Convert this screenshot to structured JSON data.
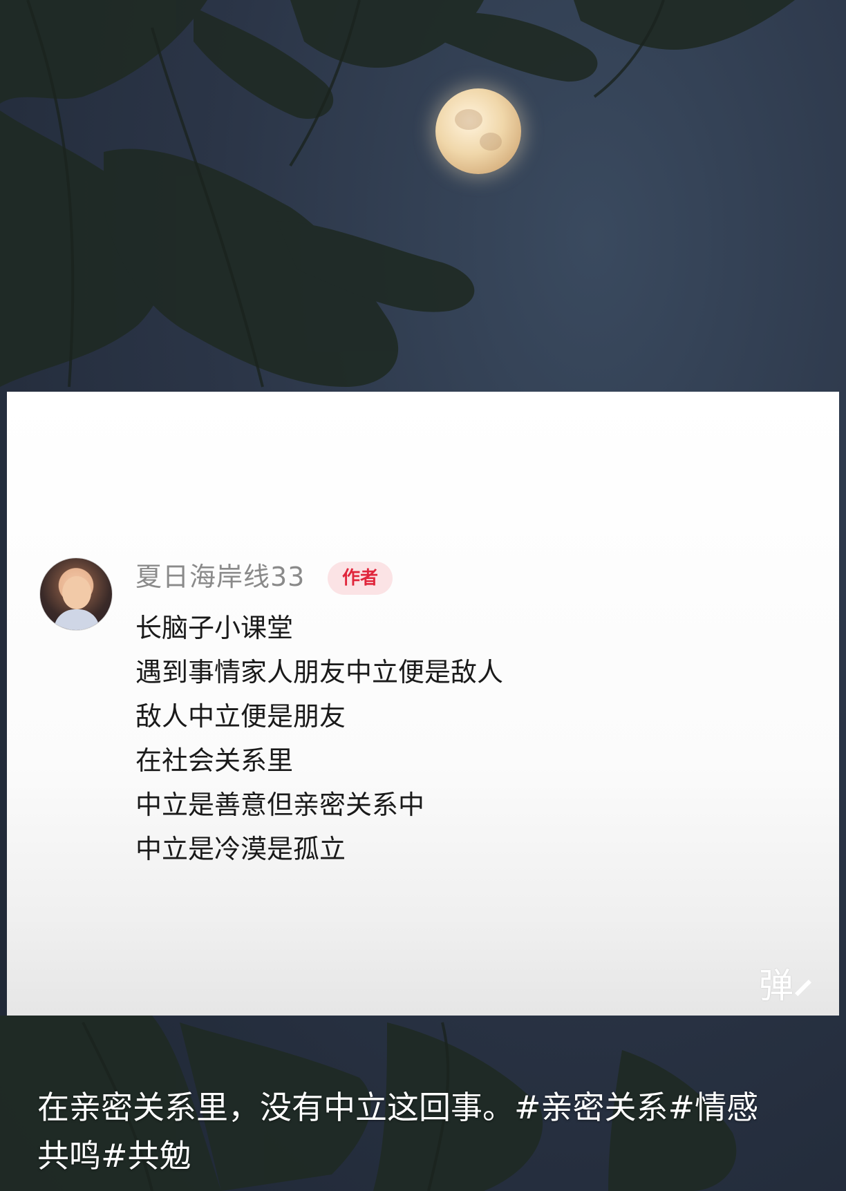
{
  "comment": {
    "username": "夏日海岸线33",
    "badge": "作者",
    "lines": [
      "长脑子小课堂",
      "遇到事情家人朋友中立便是敌人",
      "敌人中立便是朋友",
      "在社会关系里",
      "中立是善意但亲密关系中",
      "中立是冷漠是孤立"
    ]
  },
  "danmu": {
    "label": "弹",
    "icon": "danmu-edit-icon"
  },
  "caption": {
    "line1": "在亲密关系里，没有中立这回事。#亲密关系#情感",
    "line2": "共鸣#共勉"
  }
}
